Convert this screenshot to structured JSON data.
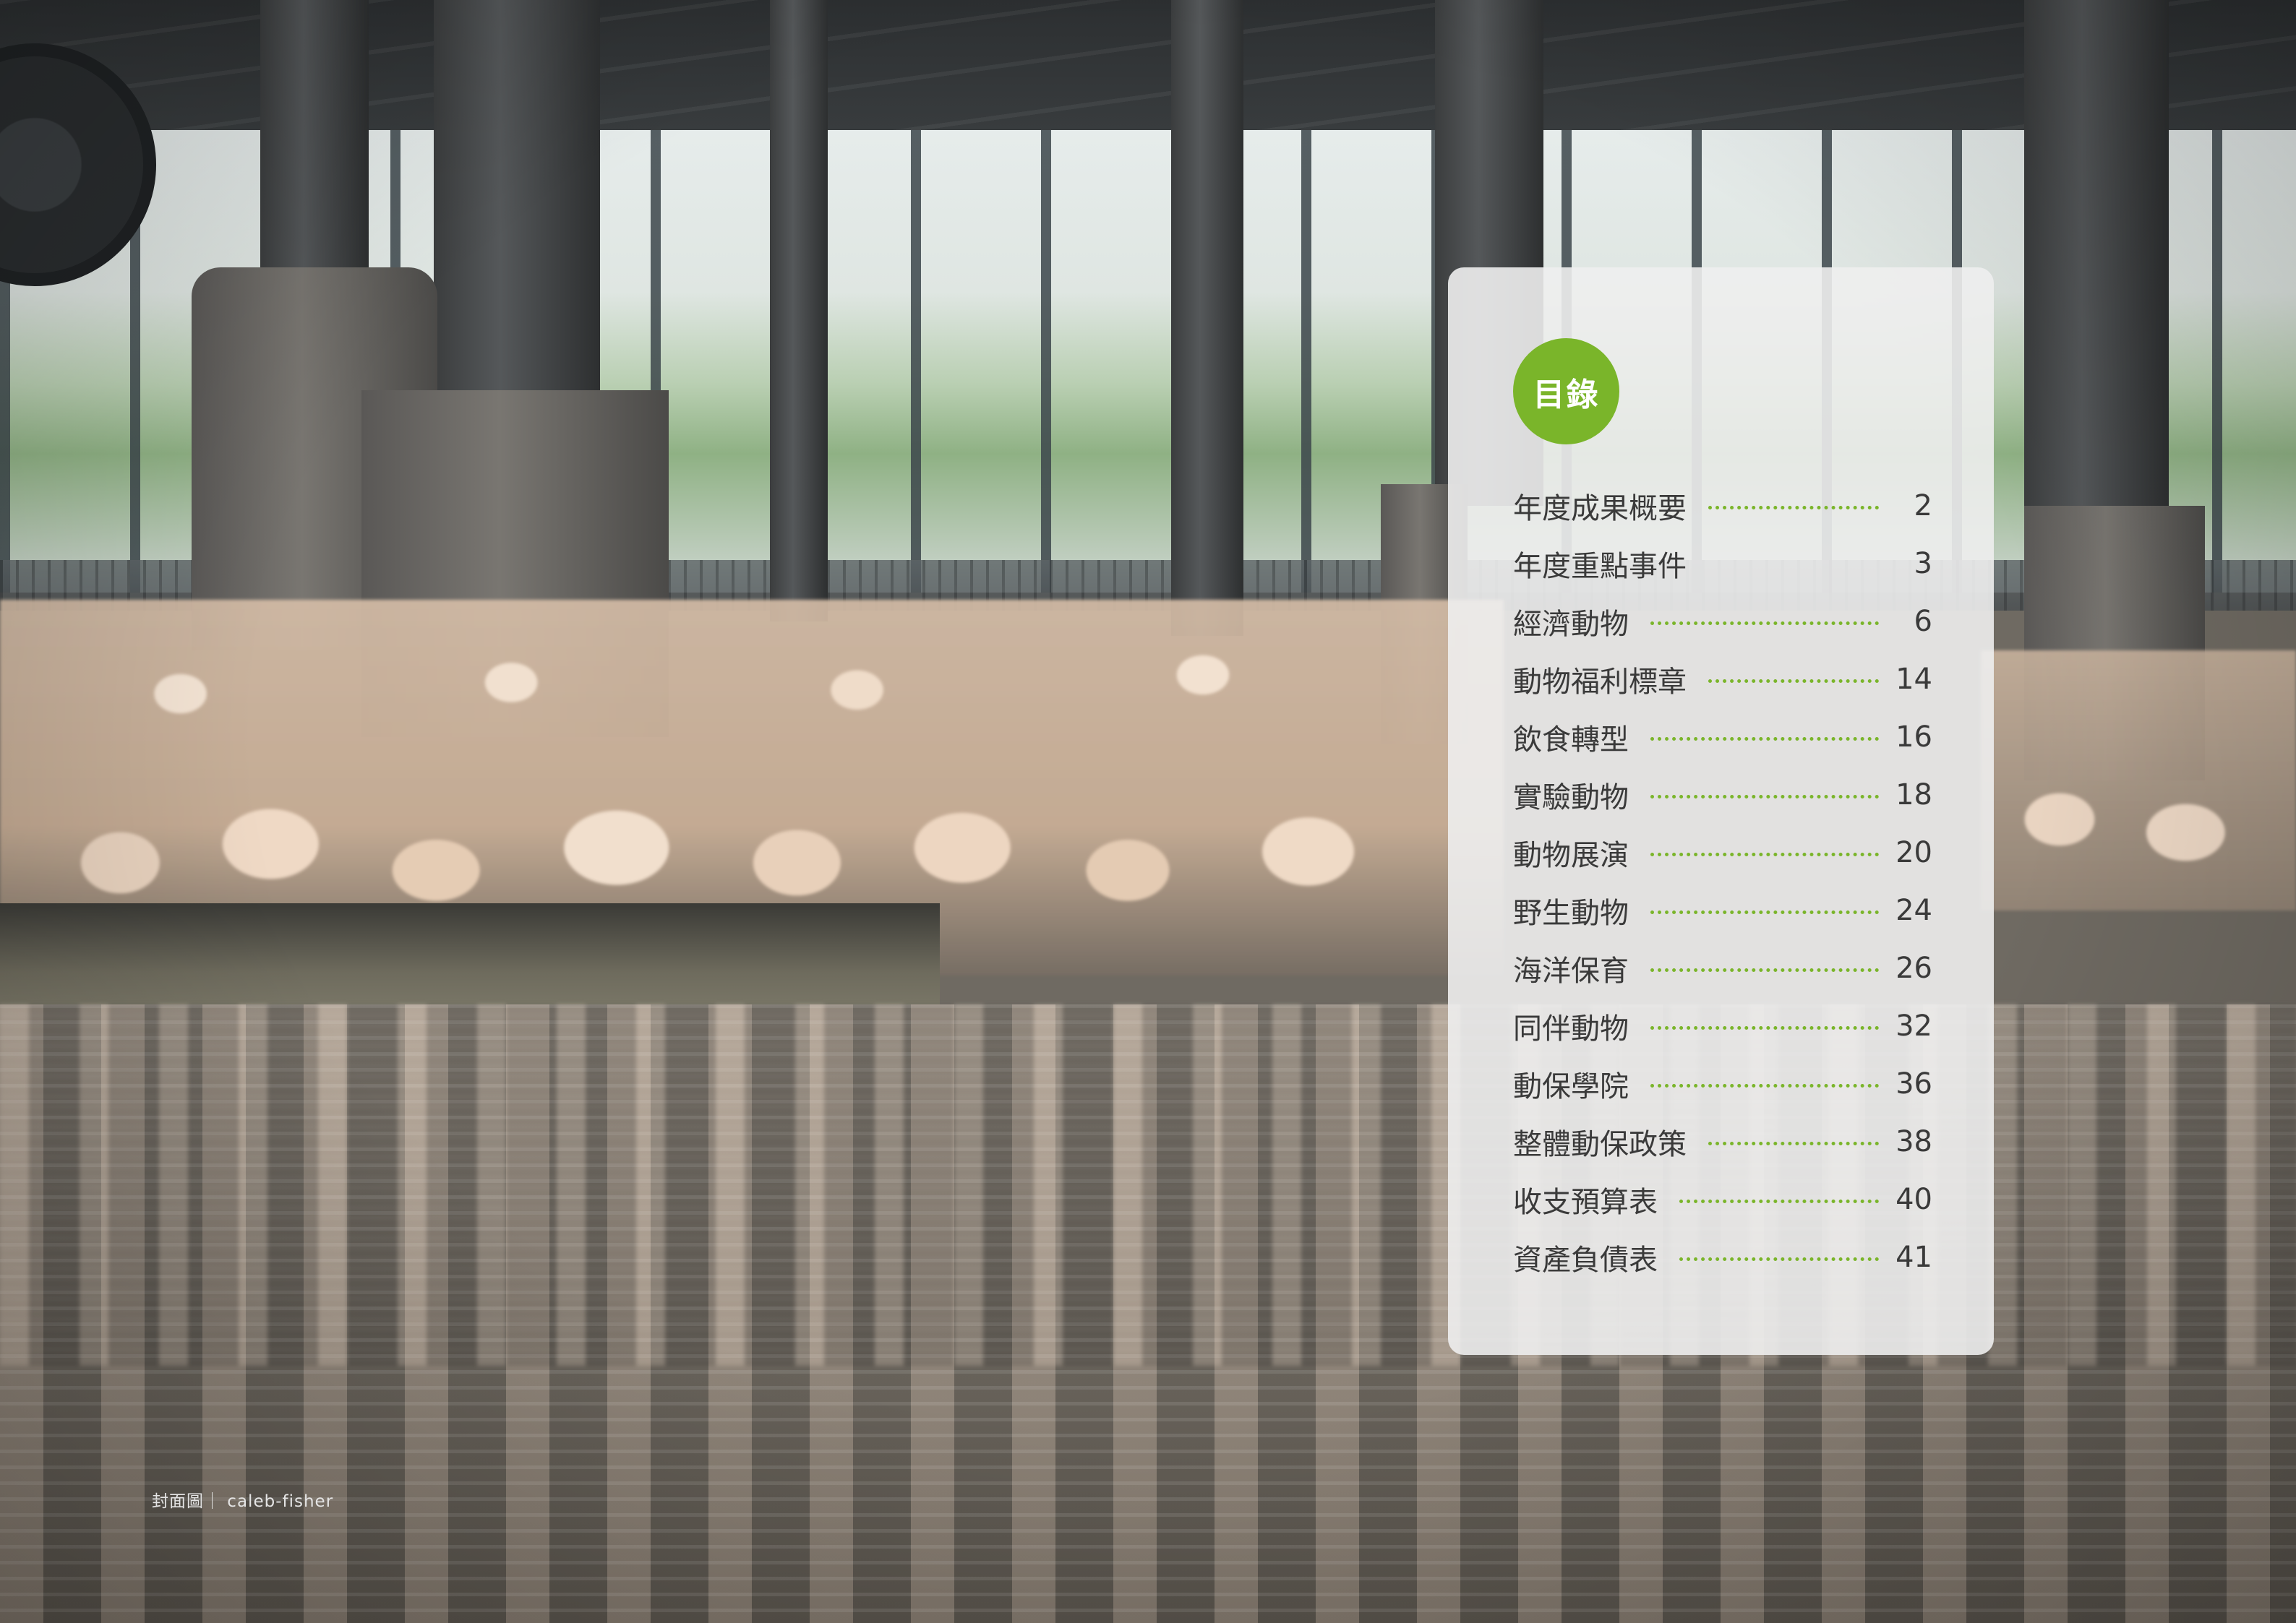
{
  "toc": {
    "title": "目錄",
    "accent_color": "#7ab52a",
    "items": [
      {
        "label": "年度成果概要",
        "page": "2",
        "leader": true
      },
      {
        "label": "年度重點事件",
        "page": "3",
        "leader": false
      },
      {
        "label": "經濟動物",
        "page": "6",
        "leader": true
      },
      {
        "label": "動物福利標章",
        "page": "14",
        "leader": true
      },
      {
        "label": "飲食轉型",
        "page": "16",
        "leader": true
      },
      {
        "label": "實驗動物",
        "page": "18",
        "leader": true
      },
      {
        "label": "動物展演",
        "page": "20",
        "leader": true
      },
      {
        "label": "野生動物",
        "page": "24",
        "leader": true
      },
      {
        "label": "海洋保育",
        "page": "26",
        "leader": true
      },
      {
        "label": "同伴動物",
        "page": "32",
        "leader": true
      },
      {
        "label": "動保學院",
        "page": "36",
        "leader": true
      },
      {
        "label": "整體動保政策",
        "page": "38",
        "leader": true
      },
      {
        "label": "收支預算表",
        "page": "40",
        "leader": true
      },
      {
        "label": "資產負債表",
        "page": "41",
        "leader": true
      }
    ]
  },
  "credit": "封面圖｜ caleb-fisher"
}
